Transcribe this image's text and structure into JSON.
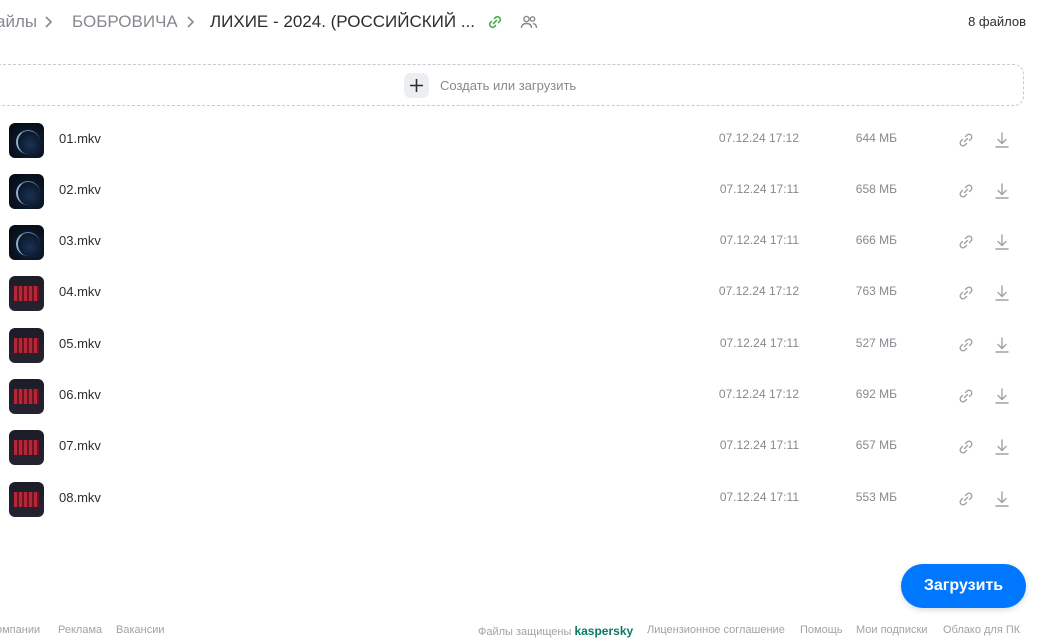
{
  "header": {
    "breadcrumbs": [
      "айлы",
      "БОБРОВИЧА",
      "ЛИХИЕ - 2024. (РОССИЙСКИЙ ..."
    ],
    "file_count": "8 файлов"
  },
  "create": {
    "label": "Создать или загрузить"
  },
  "files": [
    {
      "name": "01.mkv",
      "date": "07.12.24 17:12",
      "size": "644 МБ",
      "thumb": "space"
    },
    {
      "name": "02.mkv",
      "date": "07.12.24 17:11",
      "size": "658 МБ",
      "thumb": "space"
    },
    {
      "name": "03.mkv",
      "date": "07.12.24 17:11",
      "size": "666 МБ",
      "thumb": "space"
    },
    {
      "name": "04.mkv",
      "date": "07.12.24 17:12",
      "size": "763 МБ",
      "thumb": "red"
    },
    {
      "name": "05.mkv",
      "date": "07.12.24 17:11",
      "size": "527 МБ",
      "thumb": "red"
    },
    {
      "name": "06.mkv",
      "date": "07.12.24 17:12",
      "size": "692 МБ",
      "thumb": "red"
    },
    {
      "name": "07.mkv",
      "date": "07.12.24 17:11",
      "size": "657 МБ",
      "thumb": "red"
    },
    {
      "name": "08.mkv",
      "date": "07.12.24 17:11",
      "size": "553 МБ",
      "thumb": "red"
    }
  ],
  "upload_button": "Загрузить",
  "footer": {
    "left": [
      "омпании",
      "Реклама",
      "Вакансии"
    ],
    "protected_prefix": "Файлы защищены",
    "protected_brand": "kaspersky",
    "right": [
      "Лицензионное соглашение",
      "Помощь",
      "Мои подписки",
      "Облако для ПК"
    ]
  },
  "colors": {
    "accent": "#0077ff",
    "share_link_active": "#4caf50",
    "muted_text": "#87898f"
  },
  "icons": {
    "share": "link-icon",
    "shared_users": "users-icon",
    "download": "download-icon",
    "create": "plus-icon"
  }
}
